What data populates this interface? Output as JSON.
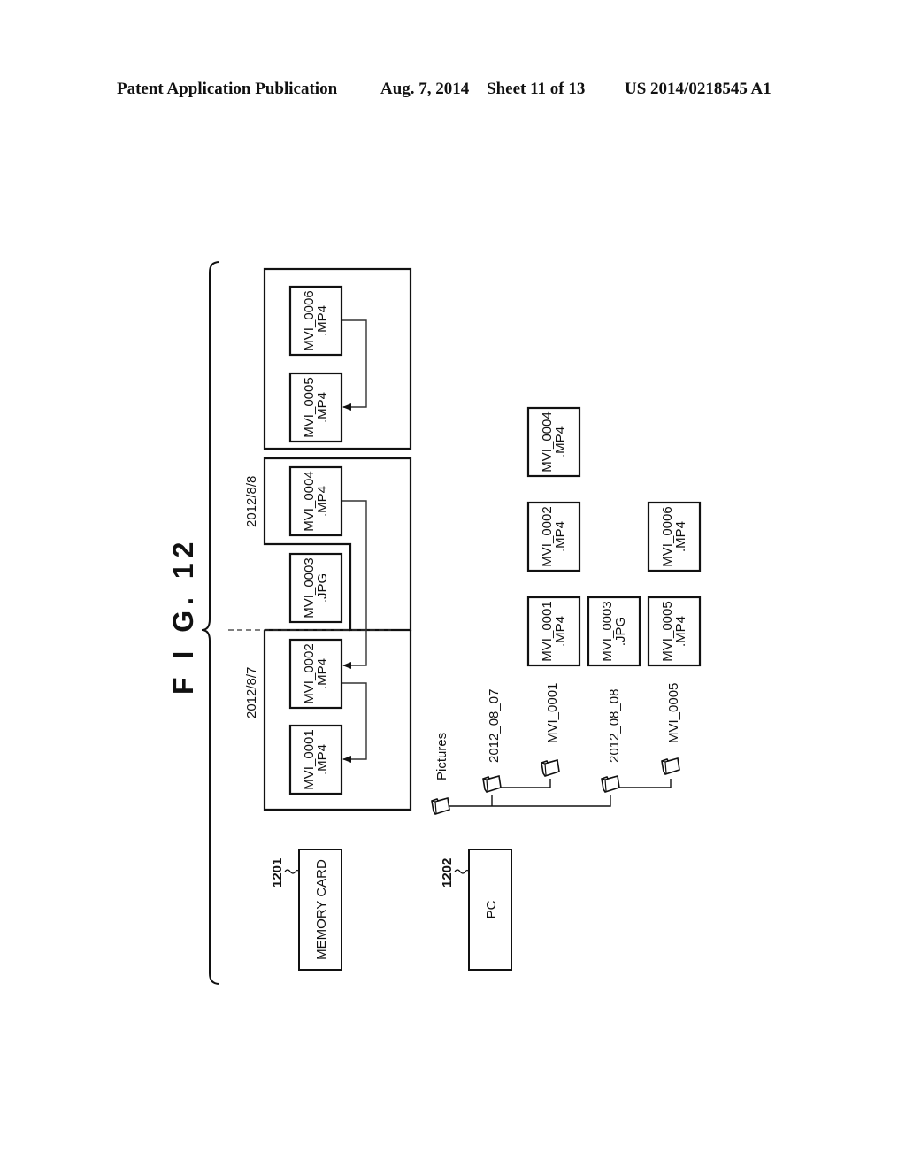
{
  "header": {
    "publication": "Patent Application Publication",
    "date": "Aug. 7, 2014",
    "sheet": "Sheet 11 of 13",
    "number": "US 2014/0218545 A1"
  },
  "figure": {
    "title": "F I G. 12",
    "memory_card": {
      "ref": "1201",
      "label": "MEMORY CARD",
      "groups": [
        {
          "date": "2012/8/7",
          "files": [
            "MVI_0001.MP4",
            "MVI_0002.MP4"
          ]
        },
        {
          "date": "2012/8/8",
          "files": [
            "MVI_0003.JPG",
            "MVI_0004.MP4"
          ]
        },
        {
          "date": "",
          "files": [
            "MVI_0005.MP4",
            "MVI_0006.MP4"
          ]
        }
      ],
      "files": [
        {
          "name": "MVI_0001",
          "ext": ".MP4"
        },
        {
          "name": "MVI_0002",
          "ext": ".MP4"
        },
        {
          "name": "MVI_0003",
          "ext": ".JPG"
        },
        {
          "name": "MVI_0004",
          "ext": ".MP4"
        },
        {
          "name": "MVI_0005",
          "ext": ".MP4"
        },
        {
          "name": "MVI_0006",
          "ext": ".MP4"
        }
      ],
      "links": [
        {
          "from": "MVI_0002",
          "to": "MVI_0001"
        },
        {
          "from": "MVI_0004",
          "to": "MVI_0002"
        },
        {
          "from": "MVI_0006",
          "to": "MVI_0005"
        }
      ]
    },
    "pc": {
      "ref": "1202",
      "label": "PC",
      "tree": {
        "root": "Pictures",
        "folders": [
          {
            "name": "2012_08_07",
            "children": [
              "MVI_0001"
            ]
          },
          {
            "name": "2012_08_08",
            "children": [
              "MVI_0005"
            ]
          }
        ]
      },
      "folder_contents": [
        {
          "folder": "MVI_0001",
          "files": [
            {
              "name": "MVI_0001",
              "ext": ".MP4"
            },
            {
              "name": "MVI_0002",
              "ext": ".MP4"
            },
            {
              "name": "MVI_0004",
              "ext": ".MP4"
            }
          ]
        },
        {
          "folder": "2012_08_08",
          "files": [
            {
              "name": "MVI_0003",
              "ext": ".JPG"
            }
          ]
        },
        {
          "folder": "MVI_0005",
          "files": [
            {
              "name": "MVI_0005",
              "ext": ".MP4"
            },
            {
              "name": "MVI_0006",
              "ext": ".MP4"
            }
          ]
        }
      ]
    }
  }
}
